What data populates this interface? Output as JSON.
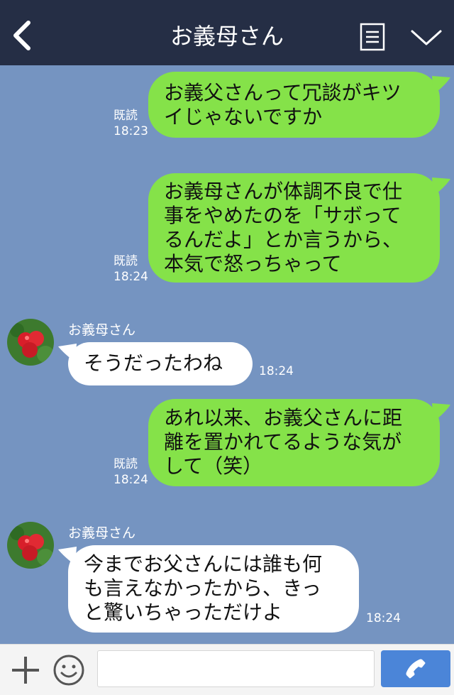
{
  "header": {
    "title": "お義母さん"
  },
  "icons": {
    "back": "chevron-left-icon",
    "menu": "menu-list-icon",
    "collapse": "chevron-down-icon",
    "plus": "plus-icon",
    "emoji": "smile-icon",
    "call": "phone-icon"
  },
  "colors": {
    "header_bg": "#252e45",
    "chat_bg": "#7594c1",
    "my_bubble": "#85e249",
    "their_bubble": "#ffffff",
    "call_button": "#4b85d8"
  },
  "messages": [
    {
      "from": "me",
      "lines": [
        "お義父さんって冗談がキツ",
        "イじゃないですか"
      ],
      "read": "既読",
      "time": "18:23"
    },
    {
      "from": "me",
      "lines": [
        "お義母さんが体調不良で仕",
        "事をやめたのを「サボって",
        "るんだよ」とか言うから、",
        "本気で怒っちゃって"
      ],
      "read": "既読",
      "time": "18:24"
    },
    {
      "from": "them",
      "sender": "お義母さん",
      "lines": [
        "そうだったわね"
      ],
      "time": "18:24"
    },
    {
      "from": "me",
      "lines": [
        "あれ以来、お義父さんに距",
        "離を置かれてるような気が",
        "して（笑）"
      ],
      "read": "既読",
      "time": "18:24"
    },
    {
      "from": "them",
      "sender": "お義母さん",
      "lines": [
        "今までお父さんには誰も何",
        "も言えなかったから、きっ",
        "と驚いちゃっただけよ"
      ],
      "time": "18:24"
    }
  ],
  "input": {
    "placeholder": "",
    "value": ""
  }
}
